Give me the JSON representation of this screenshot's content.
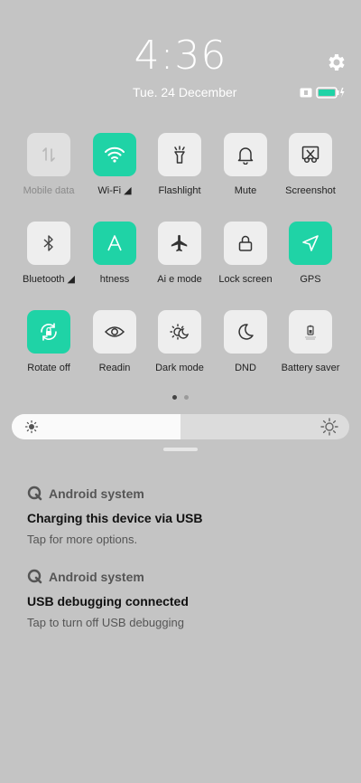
{
  "header": {
    "time": "4:36",
    "date": "Tue. 24 December"
  },
  "status": {
    "battery_icon": "battery-charging-icon",
    "sim_icon": "sim-card-icon"
  },
  "tiles": [
    {
      "label": "Mobile data",
      "state": "disabled",
      "icon": "mobile-data-icon"
    },
    {
      "label": "Wi-Fi ◢",
      "state": "on",
      "icon": "wifi-icon"
    },
    {
      "label": "Flashlight",
      "state": "off",
      "icon": "flashlight-icon"
    },
    {
      "label": "Mute",
      "state": "off",
      "icon": "bell-icon"
    },
    {
      "label": "Screenshot",
      "state": "off",
      "icon": "scissors-icon"
    },
    {
      "label": "Bluetooth ◢",
      "state": "off",
      "icon": "bluetooth-icon"
    },
    {
      "label": "htness",
      "state": "on",
      "icon": "auto-brightness-icon"
    },
    {
      "label": "Ai e mode",
      "state": "off",
      "icon": "airplane-icon"
    },
    {
      "label": "Lock screen",
      "state": "off",
      "icon": "lock-icon"
    },
    {
      "label": "GPS",
      "state": "on",
      "icon": "location-arrow-icon"
    },
    {
      "label": "Rotate off",
      "state": "on",
      "icon": "rotate-lock-icon"
    },
    {
      "label": "Readin",
      "state": "off",
      "icon": "eye-icon"
    },
    {
      "label": "Dark mode",
      "state": "off",
      "icon": "dark-mode-icon"
    },
    {
      "label": "DND",
      "state": "off",
      "icon": "moon-icon"
    },
    {
      "label": "Battery saver",
      "state": "off",
      "icon": "battery-saver-icon"
    }
  ],
  "brightness": {
    "level": 0.5
  },
  "notifications": [
    {
      "app": "Android system",
      "title": "Charging this device via USB",
      "body": "Tap for more options."
    },
    {
      "app": "Android system",
      "title": "USB debugging connected",
      "body": "Tap to turn off USB debugging"
    }
  ],
  "colors": {
    "accent": "#1fd3a6",
    "background": "#c4c4c4"
  }
}
